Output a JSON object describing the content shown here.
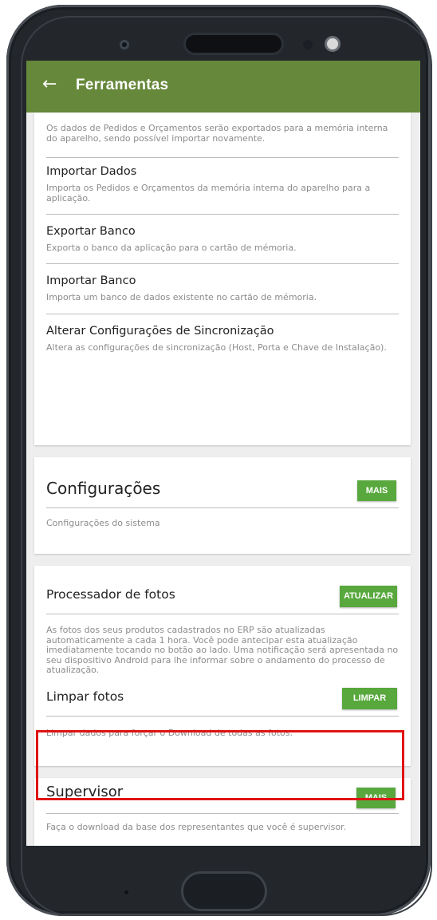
{
  "app": {
    "title": "Ferramentas",
    "back_icon": "arrow-left-icon",
    "colors": {
      "appbar": "#66883a",
      "button": "#58a83d",
      "highlight": "#e01414"
    }
  },
  "tools": {
    "export_desc": "Os dados de Pedidos e Orçamentos serão exportados para a memória interna do aparelho, sendo possível importar novamente.",
    "items": [
      {
        "title": "Importar Dados",
        "desc": "Importa os Pedidos e Orçamentos da memória interna do aparelho para a aplicação."
      },
      {
        "title": "Exportar Banco",
        "desc": "Exporta o banco da aplicação para o cartão de mémoria."
      },
      {
        "title": "Importar Banco",
        "desc": "Importa um banco de dados existente no cartão de mémoria."
      },
      {
        "title": "Alterar Configurações de Sincronização",
        "desc": "Altera as configurações de sincronização (Host, Porta e Chave de Instalação)."
      }
    ]
  },
  "config": {
    "title": "Configurações",
    "button": "MAIS",
    "desc": "Configurações do sistema"
  },
  "photos": {
    "processor_title": "Processador de fotos",
    "processor_button": "ATUALIZAR",
    "processor_desc": "As fotos dos seus produtos cadastrados no ERP são atualizadas automaticamente a cada 1 hora. Você pode antecipar esta atualização imediatamente tocando no botão ao lado. Uma notificação será apresentada no seu dispositivo Android para lhe informar sobre o andamento do processo de atualização.",
    "clear_title": "Limpar fotos",
    "clear_button": "LIMPAR",
    "clear_desc": "Limpar dados para forçar o Download de todas as fotos."
  },
  "supervisor": {
    "title": "Supervisor",
    "button": "MAIS",
    "desc": "Faça o download da base dos representantes que você é supervisor."
  }
}
